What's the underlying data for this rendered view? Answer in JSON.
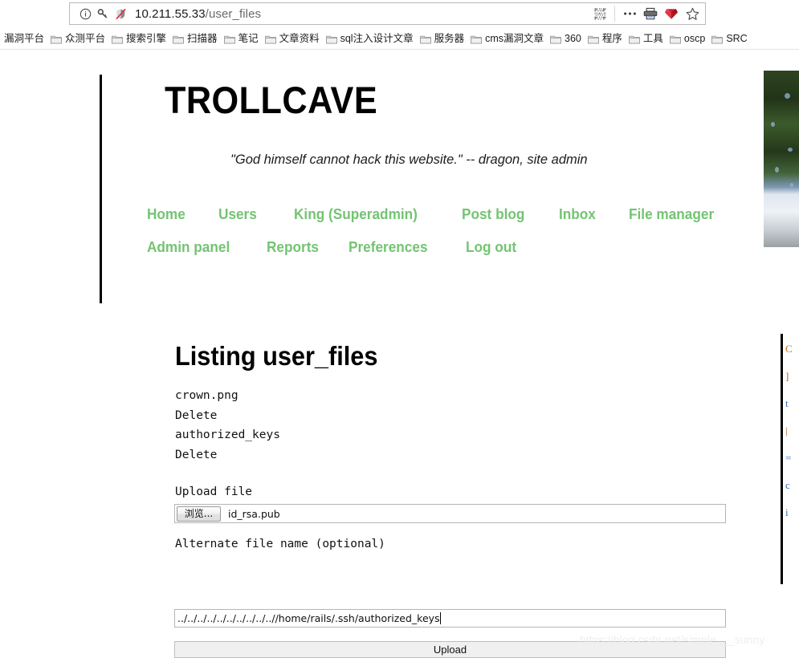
{
  "browser": {
    "urlbar": {
      "identity_icon": "info-circle-icon",
      "key_icon": "key-icon",
      "shield_icon": "shield-crossed-icon",
      "url_host": "10.211.55.33",
      "url_path": "/user_files",
      "actions": [
        {
          "name": "qr-code-icon"
        },
        {
          "name": "overflow-menu-icon"
        },
        {
          "name": "reader-printer-icon"
        },
        {
          "name": "ruby-gem-icon"
        },
        {
          "name": "bookmark-star-icon"
        }
      ]
    },
    "bookmarks": [
      {
        "label": "漏洞平台",
        "has_folder_icon": false
      },
      {
        "label": "众测平台",
        "has_folder_icon": true
      },
      {
        "label": "搜索引擎",
        "has_folder_icon": true
      },
      {
        "label": "扫描器",
        "has_folder_icon": true
      },
      {
        "label": "笔记",
        "has_folder_icon": true
      },
      {
        "label": "文章资料",
        "has_folder_icon": true
      },
      {
        "label": "sql注入设计文章",
        "has_folder_icon": true
      },
      {
        "label": "服务器",
        "has_folder_icon": true
      },
      {
        "label": "cms漏洞文章",
        "has_folder_icon": true
      },
      {
        "label": "360",
        "has_folder_icon": true
      },
      {
        "label": "程序",
        "has_folder_icon": true
      },
      {
        "label": "工具",
        "has_folder_icon": true
      },
      {
        "label": "oscp",
        "has_folder_icon": true
      },
      {
        "label": "SRC",
        "has_folder_icon": true
      }
    ]
  },
  "site": {
    "title": "TROLLCAVE",
    "tagline": "\"God himself cannot hack this website.\" -- dragon, site admin",
    "accent_color": "#73c472",
    "nav_rows": [
      [
        "Home",
        "Users",
        "King (Superadmin)",
        "Post blog",
        "Inbox",
        "File manager"
      ],
      [
        "Admin panel",
        "Reports",
        "Preferences",
        "Log out"
      ]
    ]
  },
  "main": {
    "heading": "Listing user_files",
    "files": [
      {
        "name": "crown.png",
        "delete_label": "Delete"
      },
      {
        "name": "authorized_keys",
        "delete_label": "Delete"
      }
    ],
    "upload_form": {
      "file_label": "Upload file",
      "browse_button": "浏览...",
      "selected_file": "id_rsa.pub",
      "altname_label": "Alternate file name (optional)",
      "altname_value": "../../../../../../../../../..//home/rails/.ssh/authorized_keys",
      "submit_label": "Upload"
    }
  },
  "right_column_clipped": [
    "C",
    "]",
    "t",
    "|",
    "=",
    "c",
    "i"
  ],
  "watermark": "https://blog.csdn.net/simple___sunny"
}
